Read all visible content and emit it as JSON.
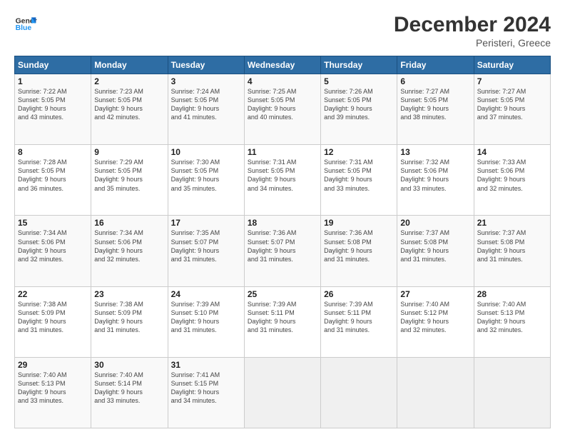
{
  "logo": {
    "line1": "General",
    "line2": "Blue"
  },
  "title": "December 2024",
  "location": "Peristeri, Greece",
  "weekdays": [
    "Sunday",
    "Monday",
    "Tuesday",
    "Wednesday",
    "Thursday",
    "Friday",
    "Saturday"
  ],
  "weeks": [
    [
      {
        "day": "1",
        "info": "Sunrise: 7:22 AM\nSunset: 5:05 PM\nDaylight: 9 hours\nand 43 minutes."
      },
      {
        "day": "2",
        "info": "Sunrise: 7:23 AM\nSunset: 5:05 PM\nDaylight: 9 hours\nand 42 minutes."
      },
      {
        "day": "3",
        "info": "Sunrise: 7:24 AM\nSunset: 5:05 PM\nDaylight: 9 hours\nand 41 minutes."
      },
      {
        "day": "4",
        "info": "Sunrise: 7:25 AM\nSunset: 5:05 PM\nDaylight: 9 hours\nand 40 minutes."
      },
      {
        "day": "5",
        "info": "Sunrise: 7:26 AM\nSunset: 5:05 PM\nDaylight: 9 hours\nand 39 minutes."
      },
      {
        "day": "6",
        "info": "Sunrise: 7:27 AM\nSunset: 5:05 PM\nDaylight: 9 hours\nand 38 minutes."
      },
      {
        "day": "7",
        "info": "Sunrise: 7:27 AM\nSunset: 5:05 PM\nDaylight: 9 hours\nand 37 minutes."
      }
    ],
    [
      {
        "day": "8",
        "info": "Sunrise: 7:28 AM\nSunset: 5:05 PM\nDaylight: 9 hours\nand 36 minutes."
      },
      {
        "day": "9",
        "info": "Sunrise: 7:29 AM\nSunset: 5:05 PM\nDaylight: 9 hours\nand 35 minutes."
      },
      {
        "day": "10",
        "info": "Sunrise: 7:30 AM\nSunset: 5:05 PM\nDaylight: 9 hours\nand 35 minutes."
      },
      {
        "day": "11",
        "info": "Sunrise: 7:31 AM\nSunset: 5:05 PM\nDaylight: 9 hours\nand 34 minutes."
      },
      {
        "day": "12",
        "info": "Sunrise: 7:31 AM\nSunset: 5:05 PM\nDaylight: 9 hours\nand 33 minutes."
      },
      {
        "day": "13",
        "info": "Sunrise: 7:32 AM\nSunset: 5:06 PM\nDaylight: 9 hours\nand 33 minutes."
      },
      {
        "day": "14",
        "info": "Sunrise: 7:33 AM\nSunset: 5:06 PM\nDaylight: 9 hours\nand 32 minutes."
      }
    ],
    [
      {
        "day": "15",
        "info": "Sunrise: 7:34 AM\nSunset: 5:06 PM\nDaylight: 9 hours\nand 32 minutes."
      },
      {
        "day": "16",
        "info": "Sunrise: 7:34 AM\nSunset: 5:06 PM\nDaylight: 9 hours\nand 32 minutes."
      },
      {
        "day": "17",
        "info": "Sunrise: 7:35 AM\nSunset: 5:07 PM\nDaylight: 9 hours\nand 31 minutes."
      },
      {
        "day": "18",
        "info": "Sunrise: 7:36 AM\nSunset: 5:07 PM\nDaylight: 9 hours\nand 31 minutes."
      },
      {
        "day": "19",
        "info": "Sunrise: 7:36 AM\nSunset: 5:08 PM\nDaylight: 9 hours\nand 31 minutes."
      },
      {
        "day": "20",
        "info": "Sunrise: 7:37 AM\nSunset: 5:08 PM\nDaylight: 9 hours\nand 31 minutes."
      },
      {
        "day": "21",
        "info": "Sunrise: 7:37 AM\nSunset: 5:08 PM\nDaylight: 9 hours\nand 31 minutes."
      }
    ],
    [
      {
        "day": "22",
        "info": "Sunrise: 7:38 AM\nSunset: 5:09 PM\nDaylight: 9 hours\nand 31 minutes."
      },
      {
        "day": "23",
        "info": "Sunrise: 7:38 AM\nSunset: 5:09 PM\nDaylight: 9 hours\nand 31 minutes."
      },
      {
        "day": "24",
        "info": "Sunrise: 7:39 AM\nSunset: 5:10 PM\nDaylight: 9 hours\nand 31 minutes."
      },
      {
        "day": "25",
        "info": "Sunrise: 7:39 AM\nSunset: 5:11 PM\nDaylight: 9 hours\nand 31 minutes."
      },
      {
        "day": "26",
        "info": "Sunrise: 7:39 AM\nSunset: 5:11 PM\nDaylight: 9 hours\nand 31 minutes."
      },
      {
        "day": "27",
        "info": "Sunrise: 7:40 AM\nSunset: 5:12 PM\nDaylight: 9 hours\nand 32 minutes."
      },
      {
        "day": "28",
        "info": "Sunrise: 7:40 AM\nSunset: 5:13 PM\nDaylight: 9 hours\nand 32 minutes."
      }
    ],
    [
      {
        "day": "29",
        "info": "Sunrise: 7:40 AM\nSunset: 5:13 PM\nDaylight: 9 hours\nand 33 minutes."
      },
      {
        "day": "30",
        "info": "Sunrise: 7:40 AM\nSunset: 5:14 PM\nDaylight: 9 hours\nand 33 minutes."
      },
      {
        "day": "31",
        "info": "Sunrise: 7:41 AM\nSunset: 5:15 PM\nDaylight: 9 hours\nand 34 minutes."
      },
      null,
      null,
      null,
      null
    ]
  ]
}
